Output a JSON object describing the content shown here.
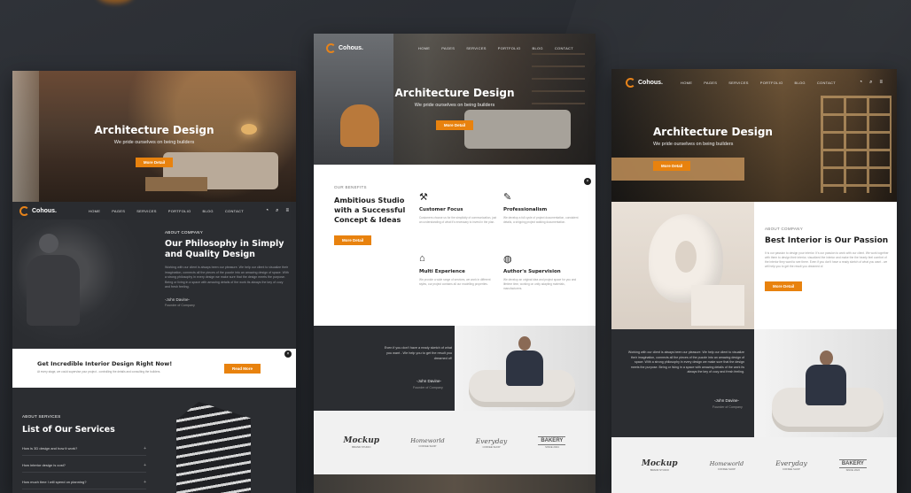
{
  "colors": {
    "accent": "#e8820e",
    "dark": "#2b2d31",
    "background": "#27292e"
  },
  "brand": {
    "logo": "Cohous."
  },
  "nav": {
    "items": [
      "HOME",
      "PAGES",
      "SERVICES",
      "PORTFOLIO",
      "BLOG",
      "CONTACT"
    ],
    "icons": [
      "cart-icon",
      "search-icon",
      "menu-icon"
    ]
  },
  "hero": {
    "title": "Architecture Design",
    "subtitle": "We pride ourselves on being builders",
    "button": "More Detail"
  },
  "mockup_left": {
    "about": {
      "tag": "ABOUT COMPANY",
      "heading": "Our Philosophy in Simply and Quality Design",
      "body": "Working with our client is always been our pleasure. We help our client to visualize their imagination, connects all the pieces of the puzzle into an amazing design of space. With a strong philosophy in every design we make sure that the design meets the purpose. Being or living in a space with amazing details of the work its always the key of cozy and fresh feeling.",
      "author": "-John Davine-",
      "author_role": "Founder of Company"
    },
    "cta": {
      "heading": "Get Incredible Interior Design Right Now!",
      "body": "At every stage, we could supervise your project - controlling the details and consulting the builders.",
      "button": "Read More"
    },
    "services": {
      "tag": "ABOUT SERVICES",
      "heading": "List of Our Services",
      "faqs": [
        "How is 3D design and how it work?",
        "How interior design is cost?",
        "How much time I will spend on planning?"
      ]
    }
  },
  "mockup_center": {
    "benefits": {
      "tag": "OUR BENEFITS",
      "heading": "Ambitious Studio with a Successful Concept & Ideas",
      "button": "More Detail",
      "features": [
        {
          "icon": "compass-icon",
          "title": "Customer Focus",
          "body": "Customers choose us for the simplicity of communication, just an understanding of what it's necessary to invest in the plan."
        },
        {
          "icon": "brush-icon",
          "title": "Professionalism",
          "body": "We develop a full cycle of project documentation, consistent details, a shipping project walking documentation."
        },
        {
          "icon": "house-icon",
          "title": "Multi Experience",
          "body": "We provide a wide range of services, we work in different styles, our project contains all our modelling properties."
        },
        {
          "icon": "globe-icon",
          "title": "Author's Supervision",
          "body": "We develop an original idea and project space for you and lifetime time, working on unity adapting materials, manufacturers."
        }
      ]
    },
    "quote": {
      "text": "Even if you don't have a ready sketch of what you want - We help you to get the result you dreamed of!",
      "author": "-John Davine-",
      "author_role": "Founder of Company"
    }
  },
  "mockup_right": {
    "about": {
      "tag": "ABOUT COMPANY",
      "heading": "Best Interior is Our Passion",
      "body": "It is our passion to design your interior. It's our passion to work with our client. We work together with them to design their interior, visualized the interior and make the the hearty feel comfort of the interior they want to see there. Even if you don't have a ready sketch of what you want - we will help you to get the result you dreamed of.",
      "button": "More Detail"
    },
    "quote": {
      "text": "Working with our client is always been our pleasure. We help our client to visualize their imagination, connects all the pieces of the puzzle into an amazing design of space. With a strong philosophy in every design we make sure that the design meets the purpose. Being or living in a space with amazing details of the work its always the key of cozy and fresh feeling.",
      "author": "-John Davine-",
      "author_role": "Founder of Company"
    }
  },
  "brands": [
    {
      "name": "Mockup",
      "sub": "BRAND STUDIO"
    },
    {
      "name": "Homeworld",
      "sub": "COFFEE SHOP"
    },
    {
      "name": "Everyday",
      "sub": "COFFEE SHOP"
    },
    {
      "name": "BAKERY",
      "sub": "SINCE 2024"
    }
  ]
}
